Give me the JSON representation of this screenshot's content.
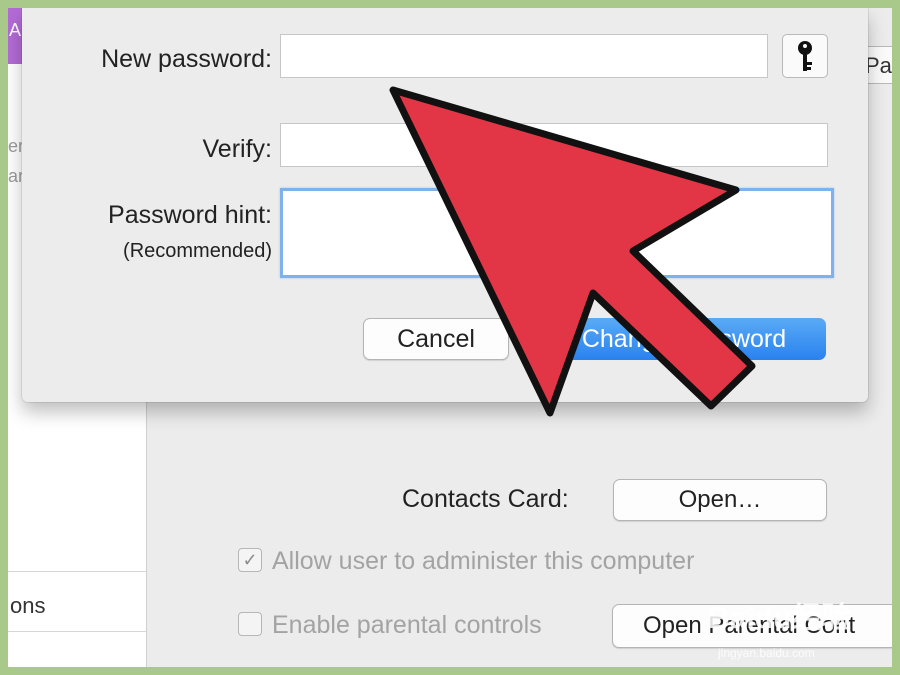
{
  "dialog": {
    "new_password_label": "New password:",
    "verify_label": "Verify:",
    "hint_label": "Password hint:",
    "hint_sublabel": "(Recommended)",
    "cancel_label": "Cancel",
    "change_label": "Change Password",
    "key_icon": "key-icon"
  },
  "background": {
    "sidebar_accent_text": "A",
    "sidebar_fragment_1": "er",
    "sidebar_fragment_2": "ar",
    "sidebar_bottom_label": "ons",
    "pass_button_label": "Pa",
    "contacts_card_label": "Contacts Card:",
    "open_button_label": "Open…",
    "admin_checkbox_label": "Allow user to administer this computer",
    "admin_checked": true,
    "parental_checkbox_label": "Enable parental controls",
    "parental_checked": false,
    "parental_button_label": "Open Parental Cont"
  },
  "watermark": {
    "text": "Baidu经验",
    "sub": "jingyan.baidu.com"
  },
  "colors": {
    "arrow_fill": "#e23646",
    "accent_purple": "#b36bd6",
    "primary_blue": "#2a82ef",
    "focus_ring": "#7fb1ea"
  }
}
